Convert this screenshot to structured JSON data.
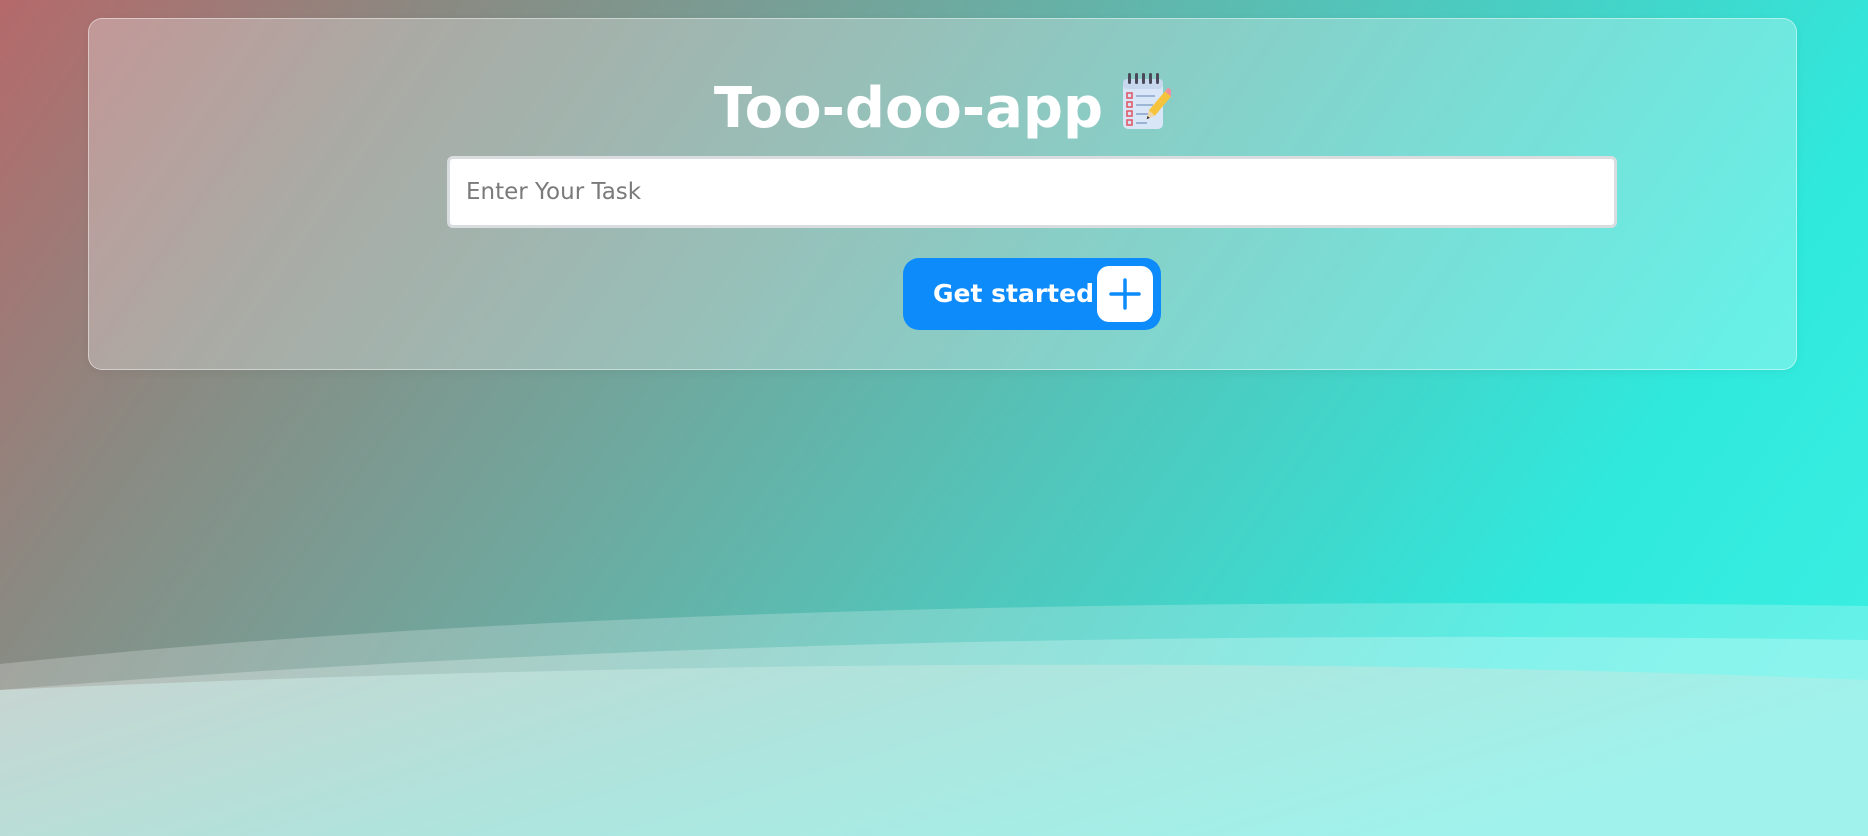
{
  "app": {
    "title": "Too-doo-app",
    "title_icon": "notepad-pencil-icon"
  },
  "task_input": {
    "placeholder": "Enter Your Task",
    "value": ""
  },
  "start_button": {
    "label": "Get started",
    "icon": "plus-icon"
  },
  "colors": {
    "button": "#0d8bfb",
    "title_text": "#ffffff",
    "background_start": "#b5696a",
    "background_end": "#3ef0e2"
  }
}
